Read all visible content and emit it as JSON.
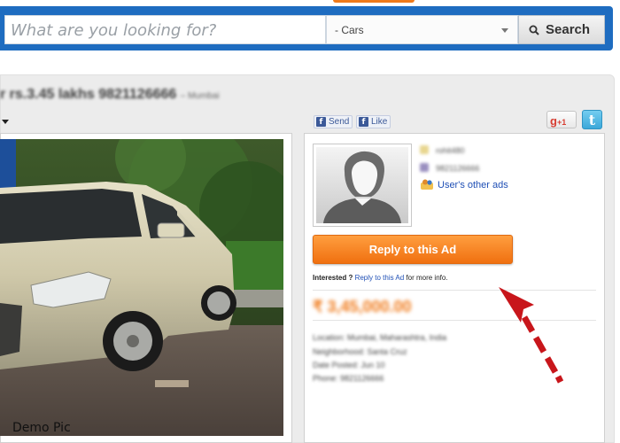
{
  "header": {
    "search_placeholder": "What are you looking for?",
    "category_selected": "- Cars",
    "search_button_label": "Search",
    "accent_color": "#1e6cc0",
    "top_tab_color": "#f07a1a"
  },
  "ad": {
    "title": "r rs.3.45 lakhs 9821126666",
    "title_suffix": "– Mumbai"
  },
  "share": {
    "send_label": "Send",
    "like_label": "Like",
    "gplus_label": "+1",
    "gplus_icon": "g",
    "twitter_icon": "t"
  },
  "photo": {
    "caption": "Demo Pic"
  },
  "seller": {
    "name": "rohit480",
    "phone": "9821126666",
    "user_ads_link": "User's other ads",
    "reply_button": "Reply to this Ad",
    "interested_prefix": "Interested ?",
    "interested_link": "Reply to this Ad",
    "interested_suffix": "for more info."
  },
  "listing": {
    "price": "₹ 3,45,000.00",
    "details": [
      "Location: Mumbai, Maharashtra, India",
      "Neighborhood: Santa Cruz",
      "Date Posted: Jun 10",
      "Phone: 9821126666"
    ]
  }
}
